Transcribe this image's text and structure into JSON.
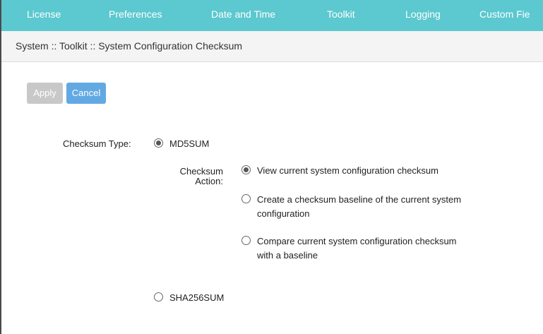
{
  "topnav": {
    "items": [
      "License",
      "Preferences",
      "Date and Time",
      "Toolkit",
      "Logging",
      "Custom Fie"
    ]
  },
  "breadcrumb": "System :: Toolkit :: System Configuration Checksum",
  "toolbar": {
    "apply_label": "Apply",
    "cancel_label": "Cancel"
  },
  "form": {
    "checksum_type_label": "Checksum Type:",
    "checksum_action_label_line1": "Checksum",
    "checksum_action_label_line2": "Action:",
    "type_options": [
      {
        "label": "MD5SUM",
        "selected": true
      },
      {
        "label": "SHA256SUM",
        "selected": false
      }
    ],
    "action_options": [
      {
        "line1": "View current system configuration checksum",
        "line2": "",
        "selected": true
      },
      {
        "line1": "Create a checksum baseline of the current system",
        "line2": "configuration",
        "selected": false
      },
      {
        "line1": "Compare current system configuration checksum",
        "line2": "with a baseline",
        "selected": false
      }
    ]
  },
  "colors": {
    "nav_bg": "#5cc8cf",
    "apply_disabled": "#c8c8c8",
    "cancel": "#62a9e3"
  }
}
